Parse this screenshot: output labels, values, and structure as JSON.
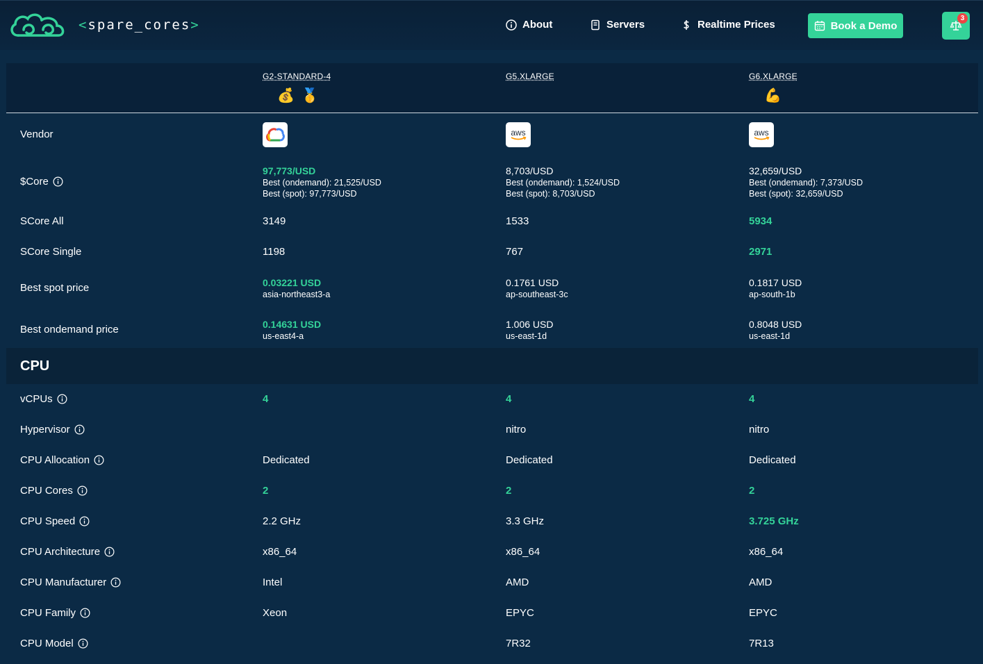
{
  "header": {
    "brand_open": "<",
    "brand_name": "spare_cores",
    "brand_close": ">",
    "nav": [
      {
        "label": "About",
        "icon": "info-icon"
      },
      {
        "label": "Servers",
        "icon": "server-icon"
      },
      {
        "label": "Realtime Prices",
        "icon": "dollar-icon"
      }
    ],
    "demo_label": "Book a Demo",
    "compare_count": "3",
    "accent": "#34d399"
  },
  "servers": [
    {
      "name": "G2-STANDARD-4",
      "emojis": [
        "💰",
        "🥇"
      ],
      "vendor": "google-cloud-logo"
    },
    {
      "name": "G5.XLARGE",
      "emojis": [],
      "vendor": "aws-logo"
    },
    {
      "name": "G6.XLARGE",
      "emojis": [
        "💪"
      ],
      "vendor": "aws-logo"
    }
  ],
  "rows": {
    "vendor_label": "Vendor",
    "aws_text": "aws",
    "score_label": "$Core",
    "score_values": [
      {
        "main": "97,773/USD",
        "ondemand": "Best (ondemand): 21,525/USD",
        "spot": "Best (spot): 97,773/USD"
      },
      {
        "main": "8,703/USD",
        "ondemand": "Best (ondemand): 1,524/USD",
        "spot": "Best (spot): 8,703/USD"
      },
      {
        "main": "32,659/USD",
        "ondemand": "Best (ondemand): 7,373/USD",
        "spot": "Best (spot): 32,659/USD"
      }
    ],
    "score_all_label": "SCore All",
    "score_all": [
      "3149",
      "1533",
      "5934"
    ],
    "score_single_label": "SCore Single",
    "score_single": [
      "1198",
      "767",
      "2971"
    ],
    "spot_label": "Best spot price",
    "spot": [
      {
        "price": "0.03221 USD",
        "zone": "asia-northeast3-a"
      },
      {
        "price": "0.1761 USD",
        "zone": "ap-southeast-3c"
      },
      {
        "price": "0.1817 USD",
        "zone": "ap-south-1b"
      }
    ],
    "ondemand_label": "Best ondemand price",
    "ondemand": [
      {
        "price": "0.14631 USD",
        "zone": "us-east4-a"
      },
      {
        "price": "1.006 USD",
        "zone": "us-east-1d"
      },
      {
        "price": "0.8048 USD",
        "zone": "us-east-1d"
      }
    ]
  },
  "cpu": {
    "section_title": "CPU",
    "vcpus_label": "vCPUs",
    "vcpus": [
      "4",
      "4",
      "4"
    ],
    "hypervisor_label": "Hypervisor",
    "hypervisor": [
      "",
      "nitro",
      "nitro"
    ],
    "allocation_label": "CPU Allocation",
    "allocation": [
      "Dedicated",
      "Dedicated",
      "Dedicated"
    ],
    "cores_label": "CPU Cores",
    "cores": [
      "2",
      "2",
      "2"
    ],
    "speed_label": "CPU Speed",
    "speed": [
      "2.2 GHz",
      "3.3 GHz",
      "3.725 GHz"
    ],
    "arch_label": "CPU Architecture",
    "arch": [
      "x86_64",
      "x86_64",
      "x86_64"
    ],
    "manufacturer_label": "CPU Manufacturer",
    "manufacturer": [
      "Intel",
      "AMD",
      "AMD"
    ],
    "family_label": "CPU Family",
    "family": [
      "Xeon",
      "EPYC",
      "EPYC"
    ],
    "model_label": "CPU Model",
    "model": [
      "",
      "7R32",
      "7R13"
    ]
  }
}
